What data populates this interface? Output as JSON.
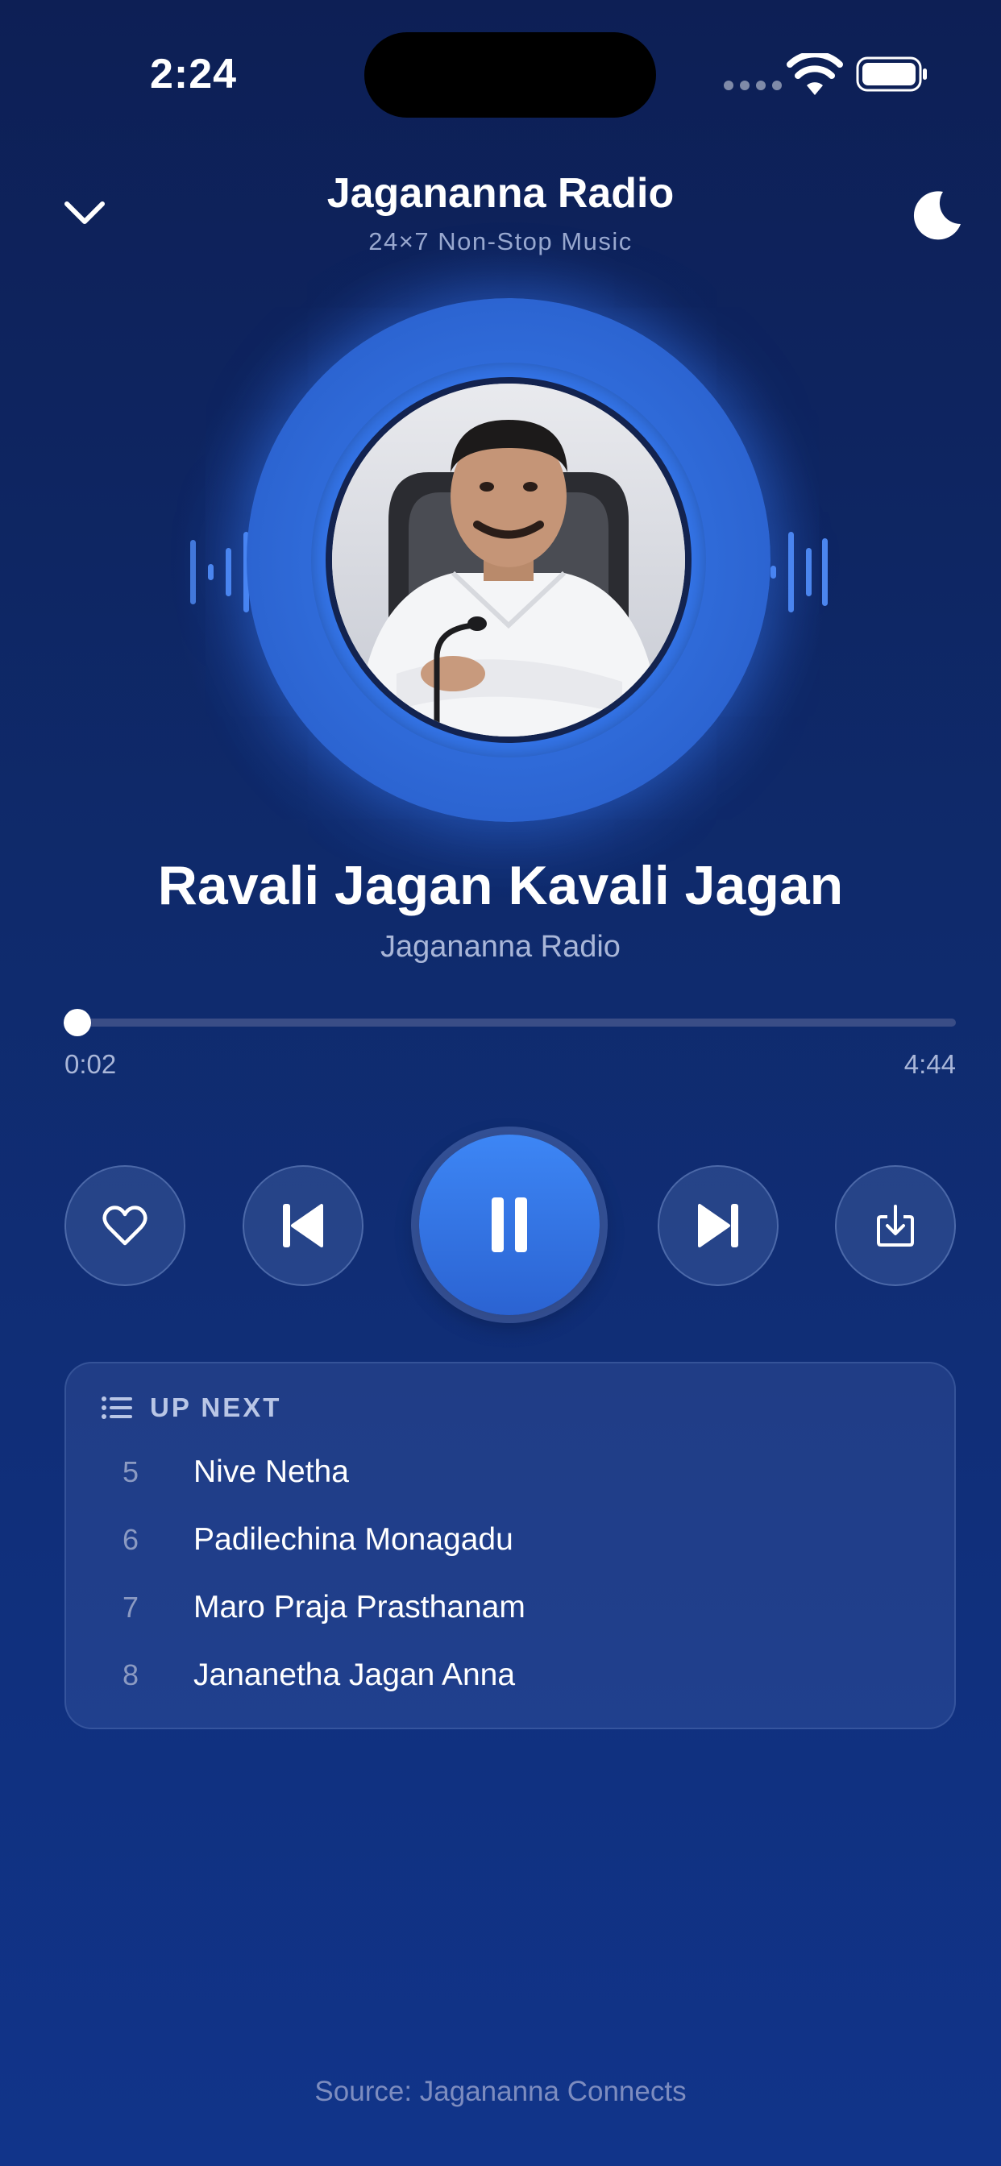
{
  "status_bar": {
    "time": "2:24"
  },
  "header": {
    "title": "Jagananna Radio",
    "subtitle": "24×7 Non-Stop Music"
  },
  "now_playing": {
    "title": "Ravali Jagan Kavali Jagan",
    "artist": "Jagananna Radio",
    "elapsed": "0:02",
    "duration": "4:44",
    "progress_fraction": 0.007
  },
  "up_next": {
    "heading": "UP NEXT",
    "items": [
      {
        "number": "5",
        "title": "Nive Netha"
      },
      {
        "number": "6",
        "title": "Padilechina Monagadu"
      },
      {
        "number": "7",
        "title": "Maro Praja Prasthanam"
      },
      {
        "number": "8",
        "title": "Jananetha Jagan Anna"
      }
    ]
  },
  "footer": {
    "source": "Source: Jagananna Connects"
  },
  "icons": [
    "chevron-down-icon",
    "moon-icon",
    "heart-icon",
    "skip-previous-icon",
    "pause-icon",
    "skip-next-icon",
    "download-icon",
    "list-icon"
  ],
  "colors": {
    "accent": "#2f6ad8",
    "background_top": "#0d1f55",
    "background_bottom": "#11348a"
  }
}
